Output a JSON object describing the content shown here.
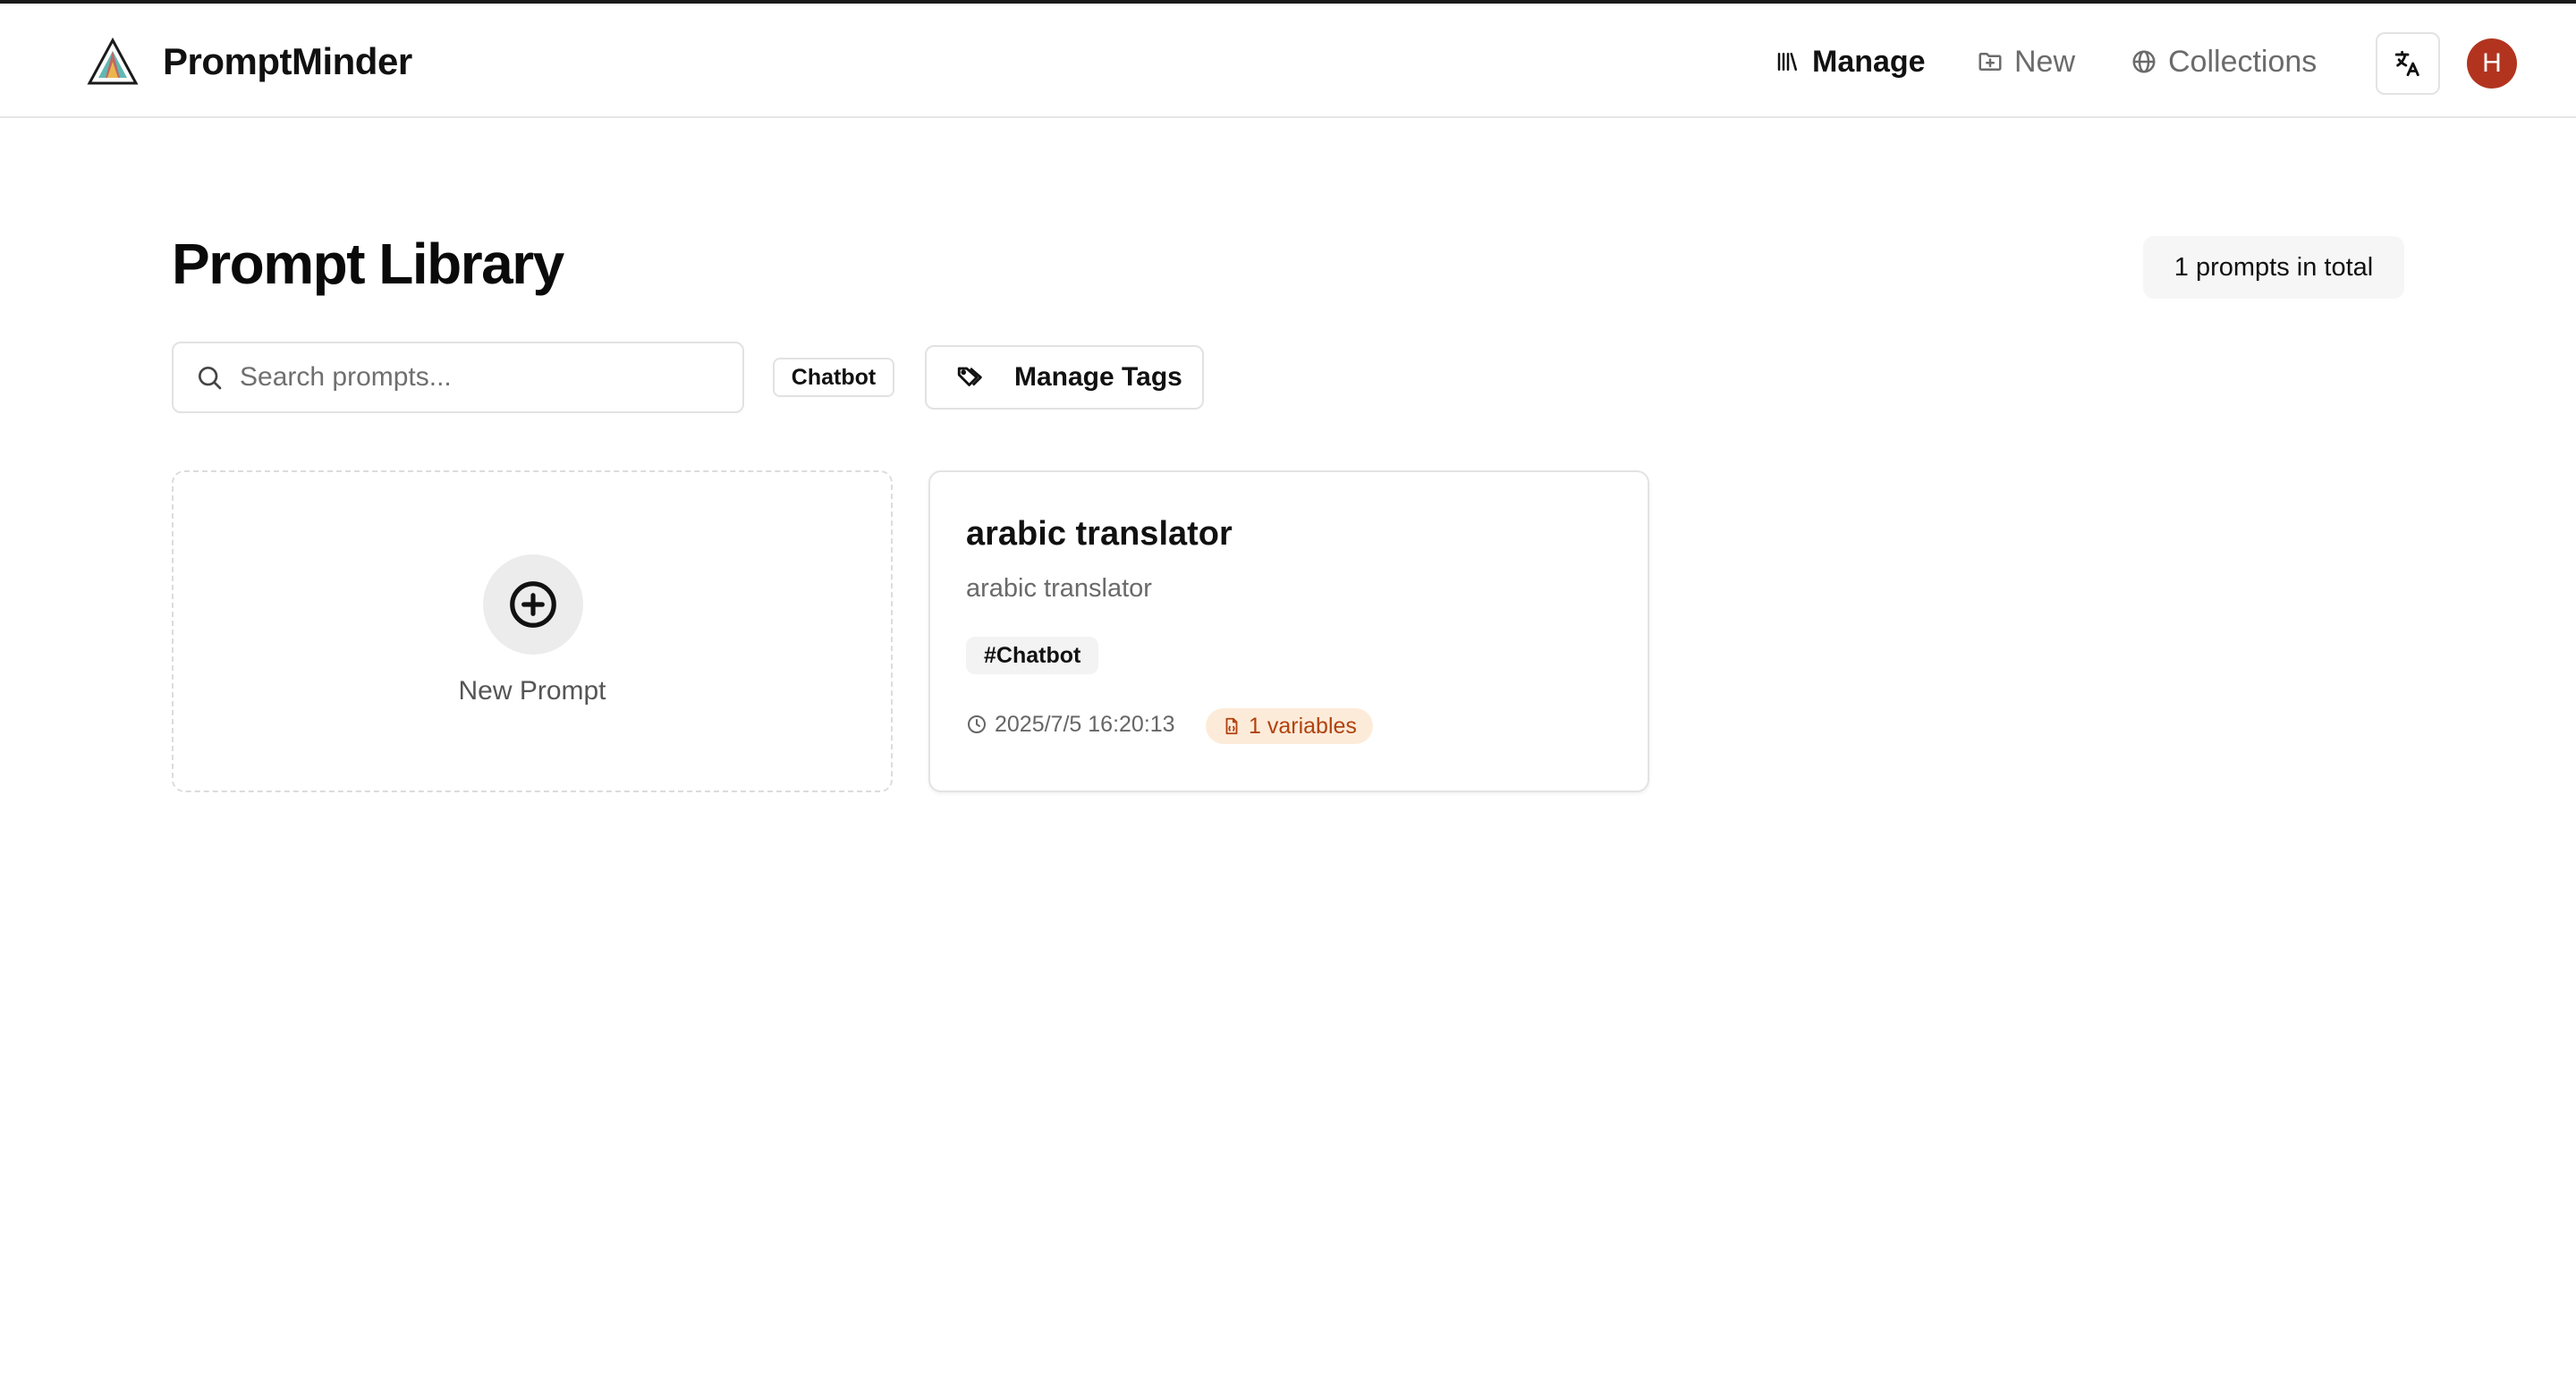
{
  "app": {
    "name": "PromptMinder"
  },
  "nav": {
    "manage": "Manage",
    "new": "New",
    "collections": "Collections",
    "avatar_initial": "H"
  },
  "page": {
    "title": "Prompt Library",
    "total": "1 prompts in total"
  },
  "search": {
    "placeholder": "Search prompts...",
    "value": ""
  },
  "filters": {
    "tag": "Chatbot",
    "manage_tags": "Manage Tags"
  },
  "new_card": {
    "label": "New Prompt"
  },
  "prompts": [
    {
      "title": "arabic translator",
      "description": "arabic translator",
      "tag": "#Chatbot",
      "timestamp": "2025/7/5 16:20:13",
      "variables": "1 variables"
    }
  ],
  "colors": {
    "avatar": "#b2341f",
    "variables_bg": "#fdebd9",
    "variables_text": "#b0420e"
  }
}
